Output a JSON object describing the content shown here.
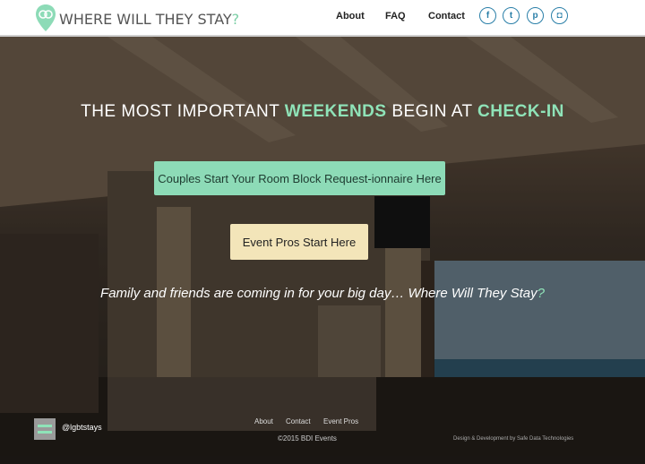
{
  "header": {
    "brand_main": "WHERE WILL THEY STAY",
    "brand_q": "?",
    "nav": [
      "About",
      "FAQ",
      "Contact"
    ],
    "social": [
      {
        "name": "facebook-icon",
        "glyph": "f"
      },
      {
        "name": "twitter-icon",
        "glyph": "t"
      },
      {
        "name": "pinterest-icon",
        "glyph": "p"
      },
      {
        "name": "instagram-icon",
        "glyph": "◘"
      }
    ]
  },
  "hero": {
    "headline_a": "THE MOST IMPORTANT ",
    "headline_b": "WEEKENDS",
    "headline_c": " BEGIN AT ",
    "headline_d": "CHECK-IN",
    "btn_couples": "Couples Start Your Room Block Request-ionnaire Here",
    "btn_pros": "Event Pros Start Here",
    "tagline_main": "Family and friends are coming in for your big day… Where Will They Stay",
    "tagline_q": "?"
  },
  "footer": {
    "handle": "@lgbtstays",
    "links": [
      "About",
      "Contact",
      "Event Pros"
    ],
    "copyright": "©2015 BDI Events",
    "credit": "Design & Development by Safe Data Technologies"
  },
  "colors": {
    "accent_green": "#8fe3b8",
    "button_green": "#8ddbb7",
    "button_cream": "#f3e5b9",
    "social_blue": "#2a7fa8"
  }
}
